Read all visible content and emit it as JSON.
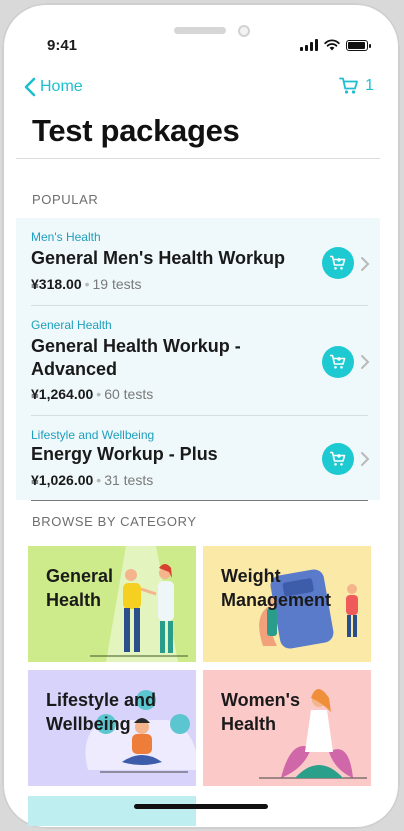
{
  "status_bar": {
    "time": "9:41"
  },
  "nav": {
    "back_label": "Home",
    "cart_count": "1"
  },
  "page_title": "Test packages",
  "popular": {
    "section_label": "POPULAR",
    "packages": [
      {
        "category": "Men's Health",
        "name": "General Men's Health Workup",
        "price": "¥318.00",
        "tests": "19 tests"
      },
      {
        "category": "General Health",
        "name": "General Health Workup - Advanced",
        "price": "¥1,264.00",
        "tests": "60 tests"
      },
      {
        "category": "Lifestyle and Wellbeing",
        "name": "Energy Workup - Plus",
        "price": "¥1,026.00",
        "tests": "31 tests"
      }
    ]
  },
  "browse": {
    "section_label": "BROWSE BY CATEGORY",
    "tiles": [
      {
        "label_line1": "General",
        "label_line2": "Health",
        "color": "#cdeb8b"
      },
      {
        "label_line1": "Weight",
        "label_line2": "Management",
        "color": "#fbe9a8"
      },
      {
        "label_line1": "Lifestyle and",
        "label_line2": "Wellbeing",
        "color": "#d8d3fb"
      },
      {
        "label_line1": "Women's",
        "label_line2": "Health",
        "color": "#fcc9c9"
      }
    ]
  },
  "colors": {
    "accent": "#1ebfcf",
    "category_blue": "#1e9fbf",
    "popular_bg": "#eff8fa"
  }
}
